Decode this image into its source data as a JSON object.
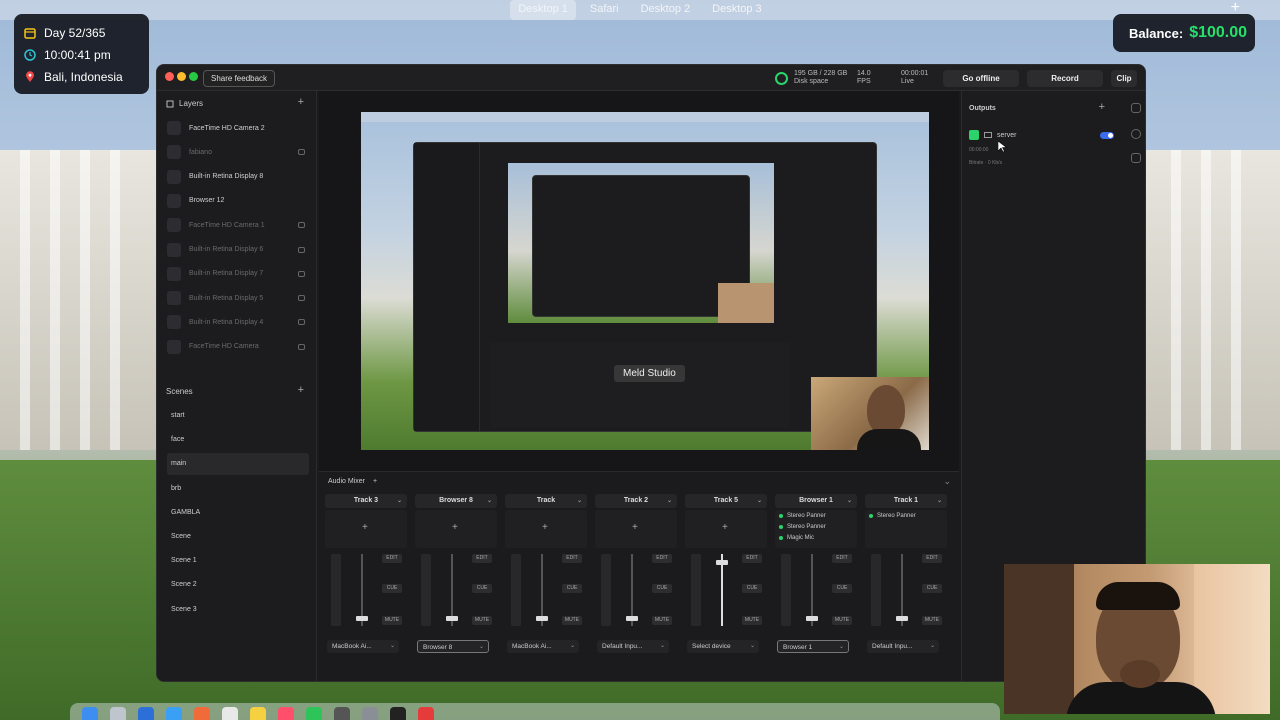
{
  "spaces": [
    "Desktop 1",
    "Safari",
    "Desktop 2",
    "Desktop 3"
  ],
  "hud": {
    "day": "Day 52/365",
    "time": "10:00:41 pm",
    "location": "Bali, Indonesia"
  },
  "balance": {
    "label": "Balance:",
    "amount": "$100.00"
  },
  "app": {
    "share_feedback": "Share feedback",
    "disk_used": "195 GB / 228 GB",
    "disk_label": "Disk space",
    "fps_value": "14.0",
    "fps_label": "FPS",
    "live_time": "00:00:01",
    "live_label": "Live",
    "go_offline": "Go offline",
    "record": "Record",
    "clip": "Clip"
  },
  "layers": {
    "title": "Layers",
    "items": [
      {
        "label": "FaceTime HD Camera 2",
        "dim": false
      },
      {
        "label": "fabiano",
        "dim": true
      },
      {
        "label": "Built-in Retina Display 8",
        "dim": false
      },
      {
        "label": "Browser 12",
        "dim": false
      },
      {
        "label": "FaceTime HD Camera 1",
        "dim": true
      },
      {
        "label": "Built-in Retina Display 6",
        "dim": true
      },
      {
        "label": "Built-in Retina Display 7",
        "dim": true
      },
      {
        "label": "Built-in Retina Display 5",
        "dim": true
      },
      {
        "label": "Built-in Retina Display 4",
        "dim": true
      },
      {
        "label": "FaceTime HD Camera",
        "dim": true
      }
    ]
  },
  "scenes": {
    "title": "Scenes",
    "items": [
      "start",
      "face",
      "main",
      "brb",
      "GAMBLA",
      "Scene",
      "Scene 1",
      "Scene 2",
      "Scene 3"
    ],
    "active": "main"
  },
  "preview": {
    "overlay_label": "Meld Studio"
  },
  "mixer": {
    "title": "Audio Mixer",
    "tracks": [
      {
        "name": "Track 3",
        "device": "MacBook Ai...",
        "fx": []
      },
      {
        "name": "Browser 8",
        "device": "Browser 8",
        "fx": []
      },
      {
        "name": "Track",
        "device": "MacBook Ai...",
        "fx": []
      },
      {
        "name": "Track 2",
        "device": "Default Inpu...",
        "fx": []
      },
      {
        "name": "Track 5",
        "device": "Select device",
        "fx": []
      },
      {
        "name": "Browser 1",
        "device": "Browser 1",
        "fx": [
          "Stereo Panner",
          "Stereo Panner",
          "Magic Mic"
        ]
      },
      {
        "name": "Track 1",
        "device": "Default Inpu...",
        "fx": [
          "Stereo Panner"
        ]
      }
    ],
    "buttons": {
      "edit": "EDIT",
      "cue": "CUE",
      "mute": "MUTE"
    }
  },
  "outputs": {
    "title": "Outputs",
    "server_name": "server",
    "server_time": "00:00:00",
    "bitrate": "Bitrate · 0 Kb/s"
  },
  "colors": {
    "accent_green": "#2bd46a",
    "balance_green": "#27e06a",
    "toggle_blue": "#3a6cf0",
    "app_bg": "#1b1b1d"
  }
}
